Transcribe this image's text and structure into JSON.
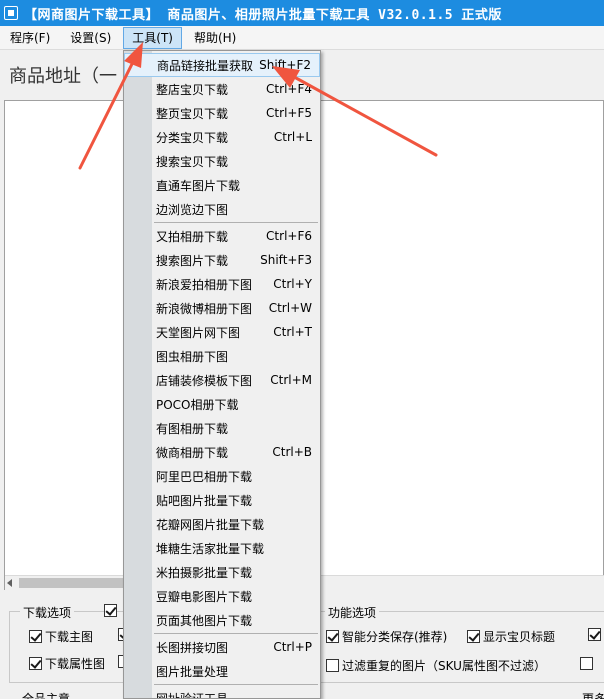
{
  "window": {
    "title": "【网商图片下载工具】 商品图片、相册照片批量下载工具 V32.0.1.5 正式版"
  },
  "menubar": [
    {
      "label": "程序(F)",
      "active": false
    },
    {
      "label": "设置(S)",
      "active": false
    },
    {
      "label": "工具(T)",
      "active": true
    },
    {
      "label": "帮助(H)",
      "active": false
    }
  ],
  "address_label": "商品地址（一",
  "tools_menu": {
    "items": [
      {
        "label": "商品链接批量获取",
        "shortcut": "Shift+F2",
        "highlighted": true
      },
      {
        "label": "整店宝贝下载",
        "shortcut": "Ctrl+F4"
      },
      {
        "label": "整页宝贝下载",
        "shortcut": "Ctrl+F5"
      },
      {
        "label": "分类宝贝下载",
        "shortcut": "Ctrl+L"
      },
      {
        "label": "搜索宝贝下载",
        "shortcut": ""
      },
      {
        "label": "直通车图片下载",
        "shortcut": ""
      },
      {
        "label": "边浏览边下图",
        "shortcut": ""
      },
      {
        "label": "又拍相册下载",
        "shortcut": "Ctrl+F6",
        "separator_before": true
      },
      {
        "label": "搜索图片下载",
        "shortcut": "Shift+F3"
      },
      {
        "label": "新浪爱拍相册下图",
        "shortcut": "Ctrl+Y"
      },
      {
        "label": "新浪微博相册下图",
        "shortcut": "Ctrl+W"
      },
      {
        "label": "天堂图片网下图",
        "shortcut": "Ctrl+T"
      },
      {
        "label": "图虫相册下图",
        "shortcut": ""
      },
      {
        "label": "店铺装修模板下图",
        "shortcut": "Ctrl+M"
      },
      {
        "label": "POCO相册下载",
        "shortcut": ""
      },
      {
        "label": "有图相册下载",
        "shortcut": ""
      },
      {
        "label": "微商相册下载",
        "shortcut": "Ctrl+B"
      },
      {
        "label": "阿里巴巴相册下载",
        "shortcut": ""
      },
      {
        "label": "贴吧图片批量下载",
        "shortcut": ""
      },
      {
        "label": "花瓣网图片批量下载",
        "shortcut": ""
      },
      {
        "label": "堆糖生活家批量下载",
        "shortcut": ""
      },
      {
        "label": "米拍摄影批量下载",
        "shortcut": ""
      },
      {
        "label": "豆瓣电影图片下载",
        "shortcut": ""
      },
      {
        "label": "页面其他图片下载",
        "shortcut": ""
      },
      {
        "label": "长图拼接切图",
        "shortcut": "Ctrl+P",
        "separator_before": true
      },
      {
        "label": "图片批量处理",
        "shortcut": ""
      },
      {
        "label": "网址验证工具",
        "shortcut": "",
        "separator_before": true
      }
    ]
  },
  "download_options": {
    "legend": "下载选项",
    "main_image": {
      "label": "下载主图",
      "checked": true
    },
    "attr_image": {
      "label": "下载属性图",
      "checked": true
    }
  },
  "function_options": {
    "legend": "功能选项",
    "smart_save": {
      "label": "智能分类保存(推荐)",
      "checked": true
    },
    "show_title": {
      "label": "显示宝贝标题",
      "checked": true
    },
    "filter_dupes": {
      "label": "过滤重复的图片（SKU属性图不过滤）",
      "checked": false
    }
  },
  "bottom_left_text": "全品主意",
  "bottom_right_text": "更多",
  "colors": {
    "titlebar": "#1d8ce0",
    "menu_highlight": "#e5f1fb",
    "arrow": "#f0553f"
  },
  "icons": {
    "app": "app-icon",
    "scroll_left": "arrow-left-icon"
  }
}
